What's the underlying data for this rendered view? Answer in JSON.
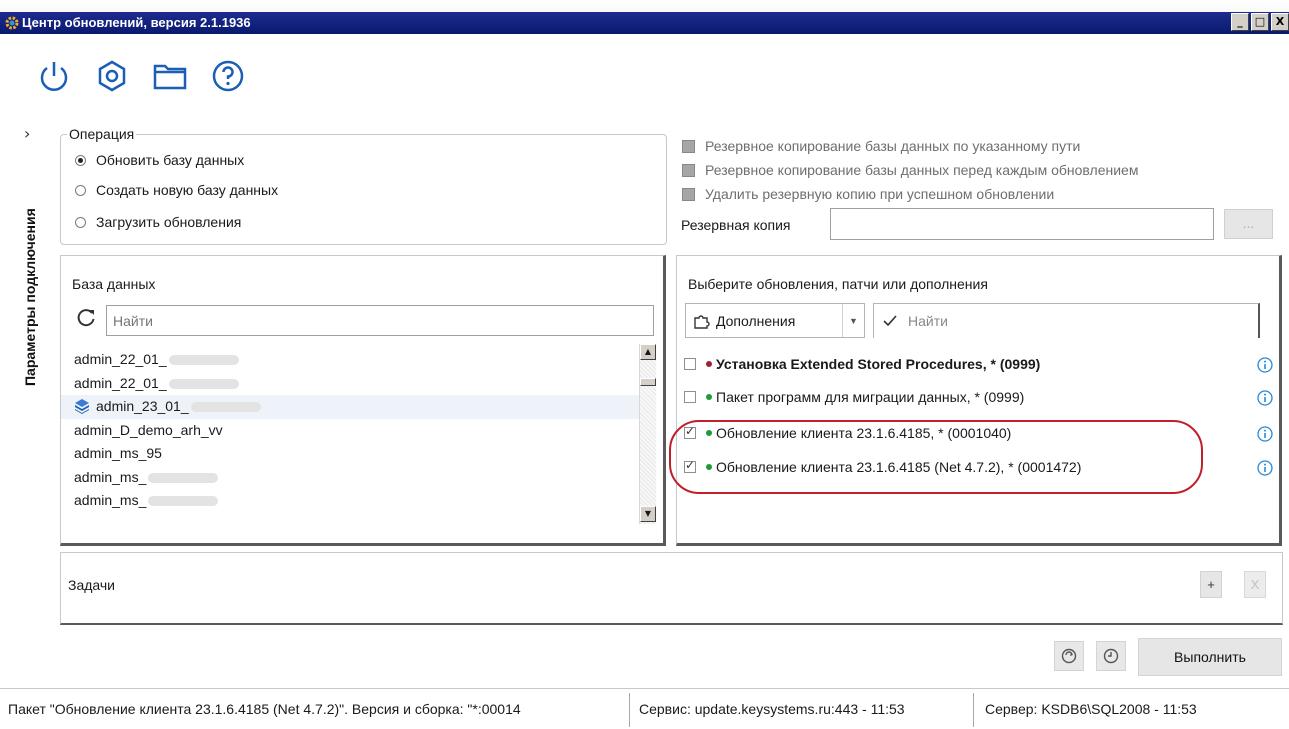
{
  "window": {
    "title": "Центр обновлений, версия 2.1.1936",
    "buttons": [
      "_",
      "□",
      "X"
    ]
  },
  "toolbar": {
    "icons": [
      "power-icon",
      "settings-icon",
      "folder-icon",
      "help-icon"
    ]
  },
  "side_panel": {
    "label": "Параметры подключения"
  },
  "operation": {
    "legend": "Операция",
    "options": [
      {
        "label": "Обновить базу данных",
        "checked": true
      },
      {
        "label": "Создать новую базу данных",
        "checked": false
      },
      {
        "label": "Загрузить обновления",
        "checked": false
      }
    ]
  },
  "backup": {
    "options": [
      "Резервное копирование базы данных по указанному пути",
      "Резервное копирование базы данных перед каждым обновлением",
      "Удалить резервную копию при успешном обновлении"
    ],
    "label": "Резервная копия",
    "value": "",
    "browse_label": "..."
  },
  "database": {
    "title": "База данных",
    "search_placeholder": "Найти",
    "items": [
      {
        "name": "admin_22_01_",
        "blurred": true,
        "selected": false
      },
      {
        "name": "admin_22_01_",
        "blurred": true,
        "selected": false
      },
      {
        "name": "admin_23_01_",
        "blurred": true,
        "selected": true
      },
      {
        "name": "admin_D_demo_arh_vv",
        "blurred": false,
        "selected": false
      },
      {
        "name": "admin_ms_95",
        "blurred": false,
        "selected": false
      },
      {
        "name": "admin_ms_",
        "blurred": true,
        "selected": false
      },
      {
        "name": "admin_ms_",
        "blurred": true,
        "selected": false
      }
    ]
  },
  "updates": {
    "title": "Выберите обновления, патчи или дополнения",
    "filter_label": "Дополнения",
    "search_placeholder": "Найти",
    "items": [
      {
        "label": "Установка Extended Stored Procedures, * (0999)",
        "checked": false,
        "bold": true,
        "dot_color": "#a0203a"
      },
      {
        "label": "Пакет программ для миграции данных, * (0999)",
        "checked": false,
        "bold": false,
        "dot_color": "#1e9a3a"
      },
      {
        "label": "Обновление клиента 23.1.6.4185, * (0001040)",
        "checked": true,
        "bold": false,
        "dot_color": "#1e9a3a"
      },
      {
        "label": "Обновление клиента 23.1.6.4185 (Net 4.7.2), * (0001472)",
        "checked": true,
        "bold": false,
        "dot_color": "#1e9a3a"
      }
    ]
  },
  "tasks": {
    "label": "Задачи",
    "add_label": "+",
    "remove_label": "X"
  },
  "actions": {
    "run_label": "Выполнить"
  },
  "statusbar": {
    "package": "Пакет \"Обновление клиента 23.1.6.4185 (Net 4.7.2)\". Версия и сборка: \"*:00014",
    "service": "Сервис:   update.keysystems.ru:443 - 11:53",
    "server": "Сервер:  KSDB6\\SQL2008 - 11:53"
  },
  "colors": {
    "titlebar": "#0a1a6e",
    "accent_icon": "#1a5fb4",
    "highlight": "#c0202a",
    "dot_green": "#1e9a3a",
    "dot_red": "#a0203a",
    "info_icon": "#2a8ad8"
  }
}
